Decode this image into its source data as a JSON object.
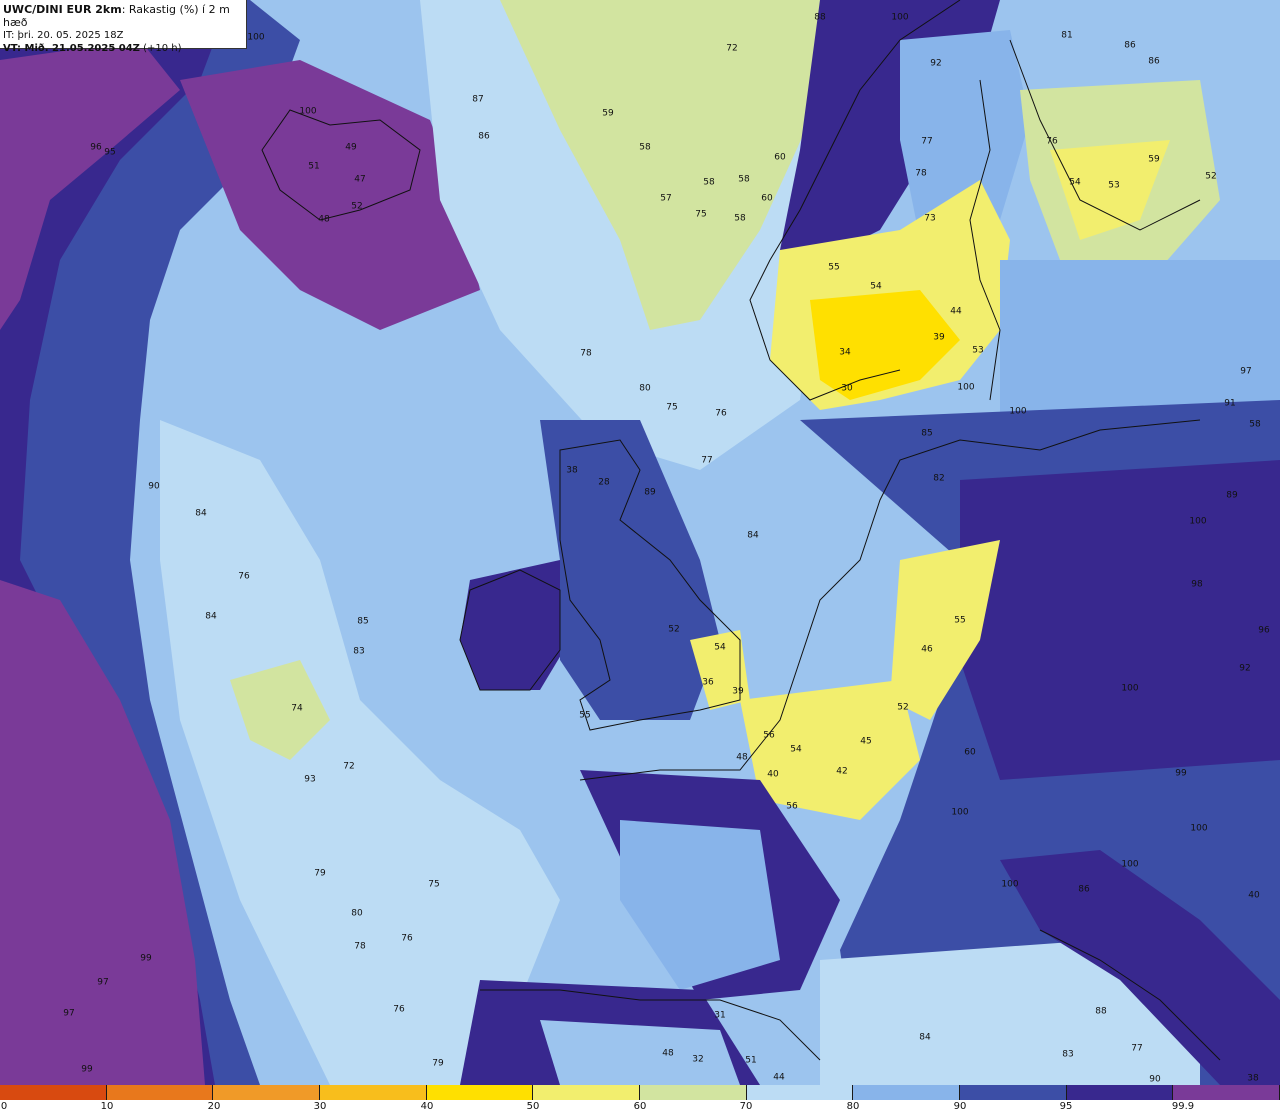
{
  "header": {
    "model": "UWC/DINI EUR 2km",
    "parameter": ": Rakastig (%) í 2 m hæð",
    "init_time": "IT: þri. 20. 05. 2025 18Z",
    "valid_time": "VT: Mið. 21.05.2025 04Z",
    "lead_time": " (+10 h)"
  },
  "legend": {
    "labels": [
      "0",
      "10",
      "20",
      "30",
      "40",
      "50",
      "60",
      "70",
      "80",
      "90",
      "95",
      "99.9"
    ],
    "colors": [
      "#d84a10",
      "#e8781c",
      "#f09a28",
      "#f8be1c",
      "#ffe000",
      "#f2ee6e",
      "#d2e4a0",
      "#bcdcf4",
      "#88b4ea",
      "#3c4ea6",
      "#38288e",
      "#7a3a98"
    ]
  },
  "values": [
    {
      "v": "88"
    },
    {
      "v": "100"
    },
    {
      "v": "72"
    },
    {
      "v": "92"
    },
    {
      "v": "81"
    },
    {
      "v": "86"
    },
    {
      "v": "86"
    },
    {
      "v": "100"
    },
    {
      "v": "96"
    },
    {
      "v": "95"
    },
    {
      "v": "100"
    },
    {
      "v": "87"
    },
    {
      "v": "86"
    },
    {
      "v": "49"
    },
    {
      "v": "51"
    },
    {
      "v": "47"
    },
    {
      "v": "52"
    },
    {
      "v": "48"
    },
    {
      "v": "59"
    },
    {
      "v": "58"
    },
    {
      "v": "57"
    },
    {
      "v": "58"
    },
    {
      "v": "58"
    },
    {
      "v": "75"
    },
    {
      "v": "58"
    },
    {
      "v": "60"
    },
    {
      "v": "60"
    },
    {
      "v": "77"
    },
    {
      "v": "78"
    },
    {
      "v": "73"
    },
    {
      "v": "76"
    },
    {
      "v": "54"
    },
    {
      "v": "53"
    },
    {
      "v": "59"
    },
    {
      "v": "52"
    },
    {
      "v": "54"
    },
    {
      "v": "44"
    },
    {
      "v": "39"
    },
    {
      "v": "34"
    },
    {
      "v": "30"
    },
    {
      "v": "53"
    },
    {
      "v": "55"
    },
    {
      "v": "78"
    },
    {
      "v": "80"
    },
    {
      "v": "75"
    },
    {
      "v": "76"
    },
    {
      "v": "77"
    },
    {
      "v": "89"
    },
    {
      "v": "84"
    },
    {
      "v": "38"
    },
    {
      "v": "28"
    },
    {
      "v": "85"
    },
    {
      "v": "82"
    },
    {
      "v": "100"
    },
    {
      "v": "100"
    },
    {
      "v": "90"
    },
    {
      "v": "84"
    },
    {
      "v": "76"
    },
    {
      "v": "84"
    },
    {
      "v": "85"
    },
    {
      "v": "83"
    },
    {
      "v": "74"
    },
    {
      "v": "93"
    },
    {
      "v": "72"
    },
    {
      "v": "52"
    },
    {
      "v": "54"
    },
    {
      "v": "36"
    },
    {
      "v": "39"
    },
    {
      "v": "55"
    },
    {
      "v": "56"
    },
    {
      "v": "54"
    },
    {
      "v": "45"
    },
    {
      "v": "40"
    },
    {
      "v": "42"
    },
    {
      "v": "56"
    },
    {
      "v": "48"
    },
    {
      "v": "55"
    },
    {
      "v": "46"
    },
    {
      "v": "52"
    },
    {
      "v": "60"
    },
    {
      "v": "100"
    },
    {
      "v": "100"
    },
    {
      "v": "100"
    },
    {
      "v": "99"
    },
    {
      "v": "100"
    },
    {
      "v": "79"
    },
    {
      "v": "80"
    },
    {
      "v": "78"
    },
    {
      "v": "76"
    },
    {
      "v": "75"
    },
    {
      "v": "99"
    },
    {
      "v": "97"
    },
    {
      "v": "97"
    },
    {
      "v": "99"
    },
    {
      "v": "76"
    },
    {
      "v": "79"
    },
    {
      "v": "31"
    },
    {
      "v": "48"
    },
    {
      "v": "32"
    },
    {
      "v": "51"
    },
    {
      "v": "44"
    },
    {
      "v": "84"
    },
    {
      "v": "77"
    },
    {
      "v": "83"
    },
    {
      "v": "88"
    },
    {
      "v": "90"
    },
    {
      "v": "86"
    },
    {
      "v": "40"
    },
    {
      "v": "38"
    },
    {
      "v": "100"
    },
    {
      "v": "98"
    },
    {
      "v": "96"
    },
    {
      "v": "92"
    },
    {
      "v": "100"
    },
    {
      "v": "89"
    },
    {
      "v": "58"
    },
    {
      "v": "91"
    },
    {
      "v": "97"
    }
  ]
}
